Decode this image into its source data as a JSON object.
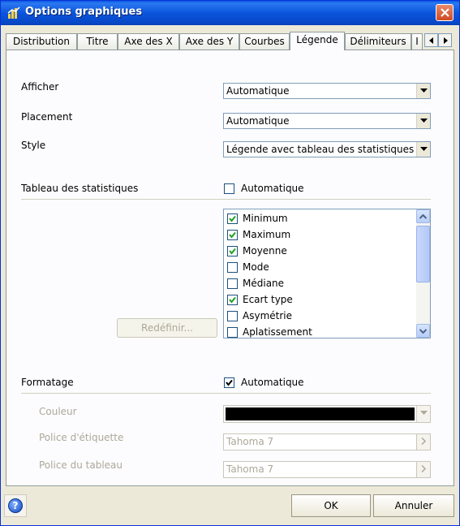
{
  "window": {
    "title": "Options graphiques",
    "title_icon": "chart-icon",
    "close_icon": "close-icon"
  },
  "tabs": [
    {
      "label": "Distribution",
      "active": false
    },
    {
      "label": "Titre",
      "active": false
    },
    {
      "label": "Axe des X",
      "active": false
    },
    {
      "label": "Axe des Y",
      "active": false
    },
    {
      "label": "Courbes",
      "active": false
    },
    {
      "label": "Légende",
      "active": true
    },
    {
      "label": "Délimiteurs",
      "active": false
    },
    {
      "label": "I",
      "active": false
    }
  ],
  "legend": {
    "afficher_label": "Afficher",
    "afficher_value": "Automatique",
    "placement_label": "Placement",
    "placement_value": "Automatique",
    "style_label": "Style",
    "style_value": "Légende avec tableau des statistiques"
  },
  "stats": {
    "section_label": "Tableau des statistiques",
    "auto_label": "Automatique",
    "auto_checked": false,
    "items": [
      {
        "label": "Minimum",
        "checked": true
      },
      {
        "label": "Maximum",
        "checked": true
      },
      {
        "label": "Moyenne",
        "checked": true
      },
      {
        "label": "Mode",
        "checked": false
      },
      {
        "label": "Médiane",
        "checked": false
      },
      {
        "label": "Ecart type",
        "checked": true
      },
      {
        "label": "Asymétrie",
        "checked": false
      },
      {
        "label": "Aplatissement",
        "checked": false
      }
    ],
    "redefine_label": "Redéfinir..."
  },
  "format": {
    "section_label": "Formatage",
    "auto_label": "Automatique",
    "auto_checked": true,
    "couleur_label": "Couleur",
    "couleur_value": "#000000",
    "police_etiquette_label": "Police d'étiquette",
    "police_etiquette_value": "Tahoma 7",
    "police_tableau_label": "Police du tableau",
    "police_tableau_value": "Tahoma 7"
  },
  "footer": {
    "ok_label": "OK",
    "cancel_label": "Annuler",
    "help_icon": "help-icon"
  }
}
